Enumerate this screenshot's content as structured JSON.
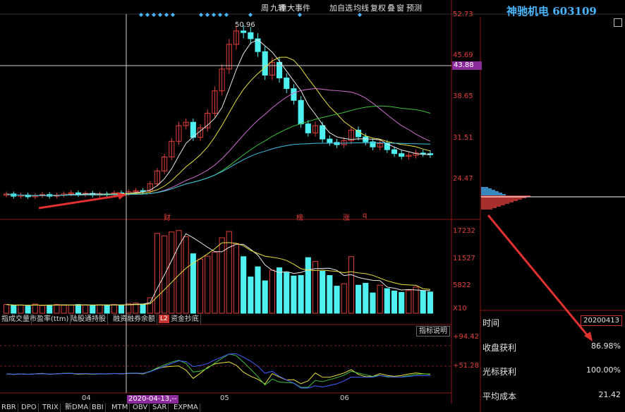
{
  "toolbar": {
    "items": [
      "周",
      "九转",
      "重大事件",
      "加自选",
      "均线",
      "复权",
      "叠",
      "窗",
      "预测"
    ],
    "title": "神驰机电 603109"
  },
  "price_axis": {
    "labels": [
      "52.73",
      "45.69",
      "38.65",
      "31.51",
      "24.47"
    ],
    "cursor_price": "43.88",
    "high_marker": "50.96"
  },
  "event_markers": [
    "财",
    "榜",
    "涨",
    "q"
  ],
  "volume_axis": {
    "labels": [
      "17232",
      "11527",
      "5822",
      "X10"
    ]
  },
  "indicator_axis": {
    "labels": [
      "+94.42",
      "+51.28"
    ]
  },
  "indicator_button": "指标说明",
  "date_axis": {
    "labels": [
      "04",
      "05",
      "06"
    ],
    "cursor_date": "2020-04-13,--"
  },
  "indicator_tabs": [
    "指成交量",
    "市盈率(ttm)",
    "陆股通持股",
    "融资融券余额",
    "资金抄底"
  ],
  "indicator_tab_badge": "L2",
  "bottom_tabs": [
    "RBR",
    "DPO",
    "TRIX",
    "新DMA",
    "BBI",
    "MTM",
    "OBV",
    "SAR",
    "EXPMA"
  ],
  "right_panel": {
    "time_label": "时间",
    "time_value": "20200413",
    "close_profit_label": "收盘获利",
    "close_profit_value": "86.98%",
    "cursor_profit_label": "光标获利",
    "cursor_profit_value": "100.00%",
    "avg_cost_label": "平均成本",
    "avg_cost_value": "21.42"
  },
  "colors": {
    "up": "#e0403a",
    "down": "#4ff0f0",
    "title": "#4ab5ff",
    "cursor_box": "#8b2a9a"
  },
  "chart_data": {
    "type": "candlestick",
    "x_ticks": [
      "04",
      "05",
      "06"
    ],
    "price_ylim": [
      19.5,
      53.5
    ],
    "candles_close": [
      21.4,
      21.0,
      21.2,
      20.9,
      21.1,
      21.3,
      21.0,
      21.2,
      21.4,
      21.6,
      21.3,
      21.5,
      21.2,
      21.4,
      21.3,
      21.6,
      21.5,
      21.8,
      22.0,
      21.9,
      23.2,
      25.5,
      28.0,
      30.8,
      33.6,
      34.2,
      31.5,
      33.2,
      35.8,
      39.8,
      43.7,
      48.1,
      50.5,
      50.2,
      49.1,
      46.8,
      42.6,
      44.9,
      42.1,
      40.2,
      38.1,
      33.9,
      32.3,
      33.6,
      31.2,
      30.6,
      30.2,
      30.9,
      32.8,
      31.6,
      30.7,
      29.8,
      30.4,
      29.3,
      28.6,
      28.1,
      28.3,
      28.7,
      28.6,
      28.4
    ],
    "volume": [
      1800,
      1600,
      1700,
      1500,
      1900,
      1600,
      1700,
      1800,
      1650,
      1700,
      1800,
      1700,
      1600,
      1750,
      1700,
      1800,
      1700,
      2000,
      2100,
      1900,
      3200,
      16500,
      16000,
      16800,
      17100,
      15800,
      12300,
      11200,
      11800,
      12600,
      15600,
      16900,
      14400,
      11700,
      7500,
      9600,
      6700,
      8900,
      9400,
      8400,
      7700,
      7800,
      11500,
      10700,
      8700,
      7800,
      5600,
      6100,
      11700,
      5800,
      6200,
      4200,
      5800,
      5100,
      4600,
      4300,
      4700,
      5400,
      4600,
      4400
    ],
    "volume_ylim": [
      0,
      17500
    ],
    "indicator_ylim": [
      30,
      110
    ]
  }
}
